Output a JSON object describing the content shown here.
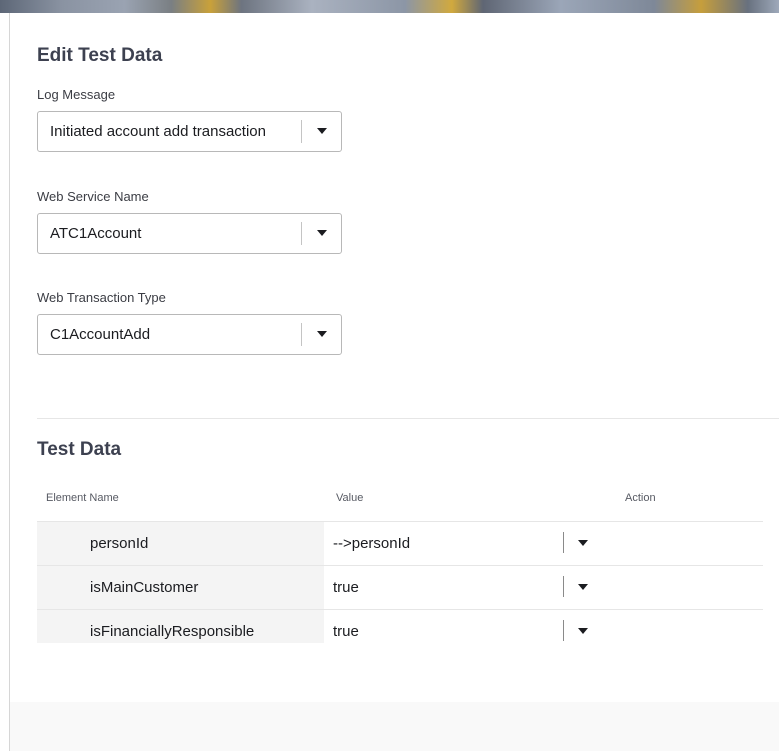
{
  "edit_section": {
    "title": "Edit Test Data",
    "fields": [
      {
        "label": "Log Message",
        "value": "Initiated account add transaction"
      },
      {
        "label": "Web Service Name",
        "value": "ATC1Account"
      },
      {
        "label": "Web Transaction Type",
        "value": "C1AccountAdd"
      }
    ]
  },
  "test_data": {
    "title": "Test Data",
    "columns": {
      "element_name": "Element Name",
      "value": "Value",
      "action": "Action"
    },
    "rows": [
      {
        "element_name": "personId",
        "value": "-->personId"
      },
      {
        "element_name": "isMainCustomer",
        "value": "true"
      },
      {
        "element_name": "isFinanciallyResponsible",
        "value": "true"
      }
    ]
  }
}
